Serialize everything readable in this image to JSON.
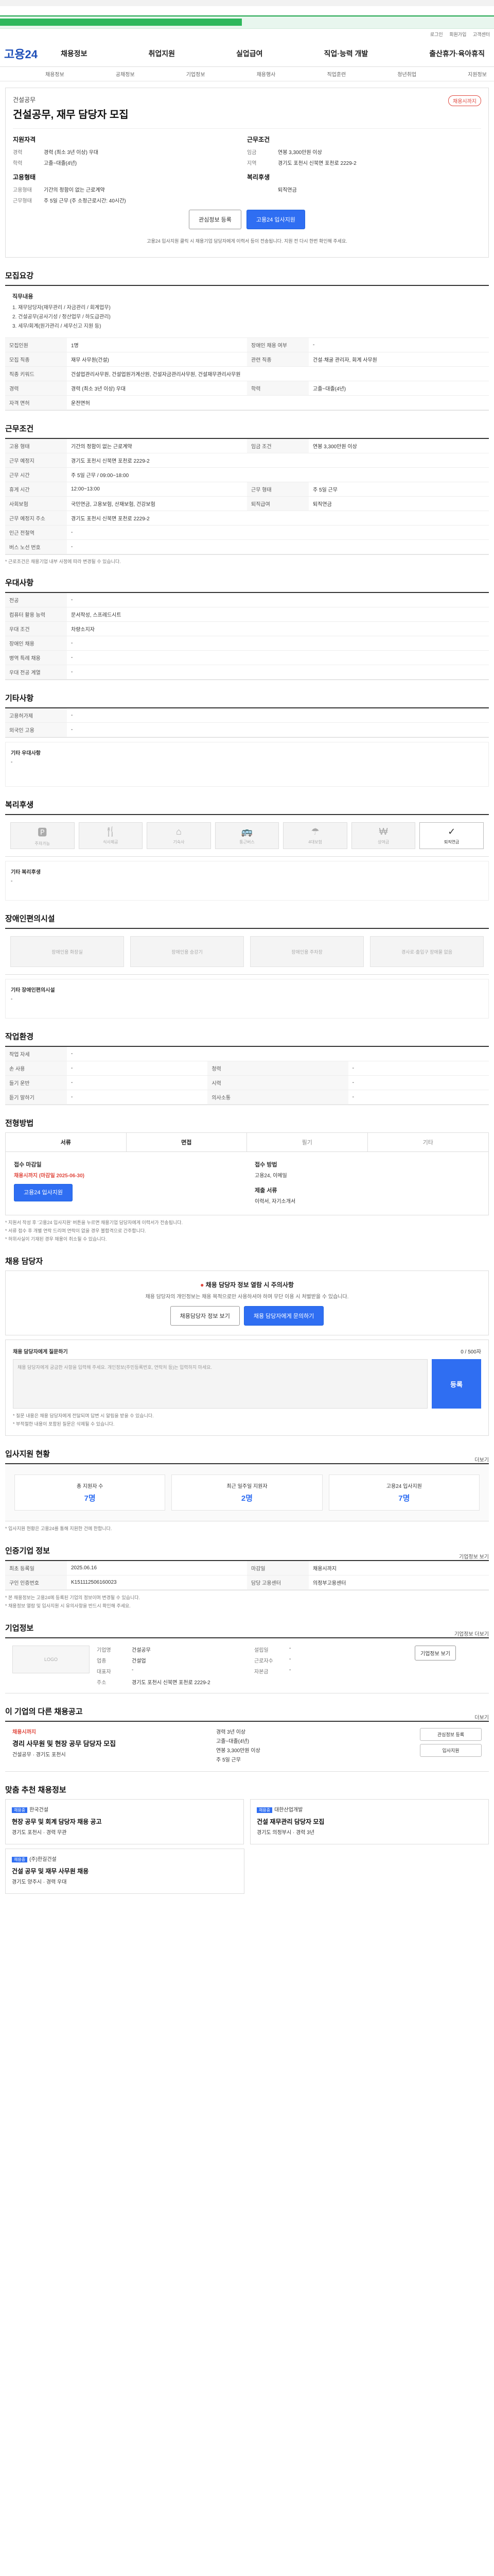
{
  "topbar": {
    "text": ""
  },
  "banner": {
    "label": ""
  },
  "util": {
    "links": [
      "로그인",
      "회원가입",
      "고객센터"
    ]
  },
  "logo": "고용24",
  "gnb": {
    "items": [
      "채용정보",
      "취업지원",
      "실업급여",
      "직업·능력 개발",
      "출산휴가·육아휴직"
    ]
  },
  "subnav": {
    "items": [
      "채용정보",
      "공채정보",
      "기업정보",
      "채용행사",
      "직업훈련",
      "청년취업",
      "지원정보"
    ]
  },
  "header": {
    "org": "건설공무",
    "title": "건설공무, 재무 담당자 모집",
    "badge": "채용시까지",
    "apply_title": "지원자격",
    "work_title": "근무조건",
    "apply_rows": [
      {
        "k": "경력",
        "v": "경력 (최소 3년 이상) 우대"
      },
      {
        "k": "학력",
        "v": "고졸~대졸(4년)"
      }
    ],
    "work_rows": [
      {
        "k": "임금",
        "v": "연봉 3,300만원 이상"
      },
      {
        "k": "지역",
        "v": "경기도 포천시 신북면 포천로 2229-2"
      }
    ],
    "extra_left_title": "고용형태",
    "extra_left_rows": [
      {
        "k": "고용형태",
        "v": "기간의 정함이 없는 근로계약"
      },
      {
        "k": "근무형태",
        "v": "주 5일 근무 (주 소정근로시간: 40시간)"
      }
    ],
    "extra_right_title": "복리후생",
    "extra_right_rows": [
      {
        "k": "",
        "v": "퇴직연금"
      }
    ],
    "btn_scrap": "관심정보 등록",
    "btn_apply": "고용24 입사지원",
    "note": "고용24 입사지원 클릭 시 채용기업 담당자에게 이력서 등이 전송됩니다. 지원 전 다시 한번 확인해 주세요."
  },
  "recruit": {
    "title": "모집요강",
    "duty_title": "직무내용",
    "duty_lines": [
      "1. 재무담당자(재무관리 / 자금관리 / 회계업무)",
      "2. 건설공무(공사기성 / 정산업무 / 하도급관리)",
      "3. 세무/회계(원가관리 / 세무신고 지원 등)"
    ],
    "rows": [
      {
        "k": "모집인원",
        "v": "1명",
        "k2": "장애인 채용 여부",
        "v2": "-"
      },
      {
        "k": "모집 직종",
        "v": "재무 사무원(건설)",
        "k2": "관련 직종",
        "v2": "건설·채굴 관리자, 회계 사무원"
      },
      {
        "k": "직종 키워드",
        "v": "건설업관리사무원, 건설업원가계산원, 건설자금관리사무원, 건설재무관리사무원",
        "k2": "",
        "v2": ""
      },
      {
        "k": "경력",
        "v": "경력 (최소 3년 이상) 우대",
        "k2": "학력",
        "v2": "고졸~대졸(4년)"
      },
      {
        "k": "자격 면허",
        "v": "운전면허",
        "k2": "",
        "v2": ""
      }
    ]
  },
  "work": {
    "title": "근무조건",
    "rows": [
      {
        "k": "고용 형태",
        "v": "기간의 정함이 없는 근로계약",
        "k2": "임금 조건",
        "v2": "연봉 3,300만원 이상"
      },
      {
        "k": "근무 예정지",
        "v": "경기도 포천시 신북면 포천로 2229-2",
        "k2": "",
        "v2": ""
      },
      {
        "k": "근무 시간",
        "v": "주 5일 근무 / 09:00~18:00",
        "k2": "",
        "v2": ""
      },
      {
        "k": "휴게 시간",
        "v": "12:00~13:00",
        "k2": "근무 형태",
        "v2": "주 5일 근무"
      },
      {
        "k": "사회보험",
        "v": "국민연금, 고용보험, 산재보험, 건강보험",
        "k2": "퇴직급여",
        "v2": "퇴직연금"
      },
      {
        "k": "근무 예정지 주소",
        "v": "경기도 포천시 신북면 포천로 2229-2",
        "k2": "",
        "v2": ""
      },
      {
        "k": "인근 전철역",
        "v": "-",
        "k2": "",
        "v2": ""
      },
      {
        "k": "버스 노선 번호",
        "v": "-",
        "k2": "",
        "v2": ""
      }
    ],
    "note": "* 근로조건은 채용기업 내부 사정에 따라 변경될 수 있습니다."
  },
  "screening": {
    "title": "우대사항",
    "rows": [
      {
        "k": "전공",
        "v": "-"
      },
      {
        "k": "컴퓨터 활용 능력",
        "v": "문서작성, 스프레드시트"
      },
      {
        "k": "우대 조건",
        "v": "차량소지자"
      },
      {
        "k": "장애인 채용",
        "v": "-"
      },
      {
        "k": "병역 특례 채용",
        "v": "-"
      },
      {
        "k": "우대 전공 계열",
        "v": "-"
      }
    ]
  },
  "etc_section": {
    "title": "기타사항",
    "rows": [
      {
        "k": "고용허가제",
        "v": "-"
      },
      {
        "k": "외국인 고용",
        "v": "-"
      }
    ],
    "etc_label": "기타 우대사항",
    "etc_value": "-"
  },
  "welfare": {
    "title": "복리후생",
    "icons": [
      {
        "name": "parking-icon",
        "label": "주차가능",
        "on": false
      },
      {
        "name": "meal-icon",
        "label": "식사제공",
        "on": false
      },
      {
        "name": "dorm-icon",
        "label": "기숙사",
        "on": false
      },
      {
        "name": "shuttle-icon",
        "label": "통근버스",
        "on": false
      },
      {
        "name": "insurance-icon",
        "label": "4대보험",
        "on": false
      },
      {
        "name": "bonus-icon",
        "label": "상여금",
        "on": false
      },
      {
        "name": "pension-icon",
        "label": "퇴직연금",
        "on": true
      }
    ],
    "other_label": "기타 복리후생",
    "other_value": "-"
  },
  "disability": {
    "title": "장애인편의시설",
    "icons": [
      "장애인용 화장실",
      "장애인용 승강기",
      "장애인용 주차장",
      "경사로·출입구 장애물 없음"
    ],
    "other_label": "기타 장애인편의시설",
    "other_value": "-"
  },
  "env": {
    "title": "작업환경",
    "rows": [
      {
        "k": "작업 자세",
        "v": "-"
      },
      {
        "k": "손 사용",
        "v": "-",
        "k2": "청력",
        "v2": "-"
      },
      {
        "k": "들기 운반",
        "v": "-",
        "k2": "시력",
        "v2": "-"
      },
      {
        "k": "듣기 말하기",
        "v": "-",
        "k2": "의사소통",
        "v2": "-"
      }
    ]
  },
  "process": {
    "title": "전형방법",
    "tabs": [
      "서류",
      "면접",
      "필기",
      "기타"
    ],
    "apply_label": "접수 마감일",
    "apply_value": "채용시까지 (마감일 2025-06-30)",
    "method_label": "접수 방법",
    "method_value": "고용24, 이메일",
    "docs_label": "제출 서류",
    "docs_value": "이력서, 자기소개서",
    "btn_apply": "고용24 입사지원",
    "notes": [
      "* 지원서 작성 후 '고용24 입사지원' 버튼을 누르면 채용기업 담당자에게 이력서가 전송됩니다.",
      "* 서류 접수 후 개별 연락 드리며 연락이 없을 경우 불합격으로 간주합니다.",
      "* 허위사실이 기재된 경우 채용이 취소될 수 있습니다."
    ]
  },
  "contact": {
    "title": "채용 담당자",
    "warn": "채용 담당자 정보 열람 시 주의사항",
    "desc": "채용 담당자의 개인정보는 채용 목적으로만 사용하셔야 하며 무단 이용 시 처벌받을 수 있습니다.",
    "btn1": "채용담당자 정보 보기",
    "btn2": "채용 담당자에게 문의하기",
    "q_title": "채용 담당자에게 질문하기",
    "q_count": "0 / 500자",
    "q_placeholder": "채용 담당자에게 궁금한 사항을 입력해 주세요. 개인정보(주민등록번호, 연락처 등)는 입력하지 마세요.",
    "q_btn": "등록",
    "q_notes": [
      "* 질문 내용은 채용 담당자에게 전달되며 답변 시 알림을 받을 수 있습니다.",
      "* 부적절한 내용이 포함된 질문은 삭제될 수 있습니다."
    ]
  },
  "stats": {
    "title": "입사지원 현황",
    "link": "더보기",
    "items": [
      {
        "label": "총 지원자 수",
        "value": "7명"
      },
      {
        "label": "최근 일주일 지원자",
        "value": "2명"
      },
      {
        "label": "고용24 입사지원",
        "value": "7명"
      }
    ],
    "note": "* 입사지원 현황은 고용24를 통해 지원한 건에 한합니다."
  },
  "info": {
    "title": "인증기업 정보",
    "link": "기업정보 보기",
    "rows": [
      {
        "k": "최초 등록일",
        "v": "2025.06.16",
        "k2": "마감일",
        "v2": "채용시까지"
      },
      {
        "k": "구인 인증번호",
        "v": "K151112506160023",
        "k2": "담당 고용센터",
        "v2": "의정부고용센터"
      }
    ],
    "notes": [
      "* 본 채용정보는 고용24에 등록된 기업의 정보이며 변경될 수 있습니다.",
      "* 채용정보 열람 및 입사지원 시 유의사항을 반드시 확인해 주세요."
    ]
  },
  "company": {
    "title": "기업정보",
    "link": "기업정보 더보기",
    "logo": "LOGO",
    "rows": [
      {
        "k": "기업명",
        "v": "건설공무",
        "k2": "설립일",
        "v2": "-"
      },
      {
        "k": "업종",
        "v": "건설업",
        "k2": "근로자수",
        "v2": "-"
      },
      {
        "k": "대표자",
        "v": "-",
        "k2": "자본금",
        "v2": "-"
      },
      {
        "k": "주소",
        "v": "경기도 포천시 신북면 포천로 2229-2",
        "k2": "",
        "v2": ""
      }
    ],
    "btn": "기업정보 보기"
  },
  "other": {
    "title": "이 기업의 다른 채용공고",
    "link": "더보기",
    "period": "채용시까지",
    "job": "경리 사무원 및 현장 공무 담당자 모집",
    "desc": "건설공무 · 경기도 포천시",
    "m_rows": [
      "경력 3년 이상",
      "고졸~대졸(4년)",
      "연봉 3,300만원 이상",
      "주 5일 근무"
    ],
    "btns": [
      "관심정보 등록",
      "입사지원"
    ]
  },
  "reco": {
    "title": "맞춤 추천 채용정보",
    "items": [
      {
        "tag": "채용중",
        "org": "한국건설",
        "job": "현장 공무 및 회계 담당자 채용 공고",
        "desc": "경기도 포천시 · 경력 무관"
      },
      {
        "tag": "채용중",
        "org": "대한산업개발",
        "job": "건설 재무관리 담당자 모집",
        "desc": "경기도 의정부시 · 경력 3년"
      }
    ],
    "more_item": {
      "tag": "채용중",
      "org": "(주)한길건설",
      "job": "건설 공무 및 재무 사무원 채용",
      "desc": "경기도 양주시 · 경력 우대"
    }
  }
}
